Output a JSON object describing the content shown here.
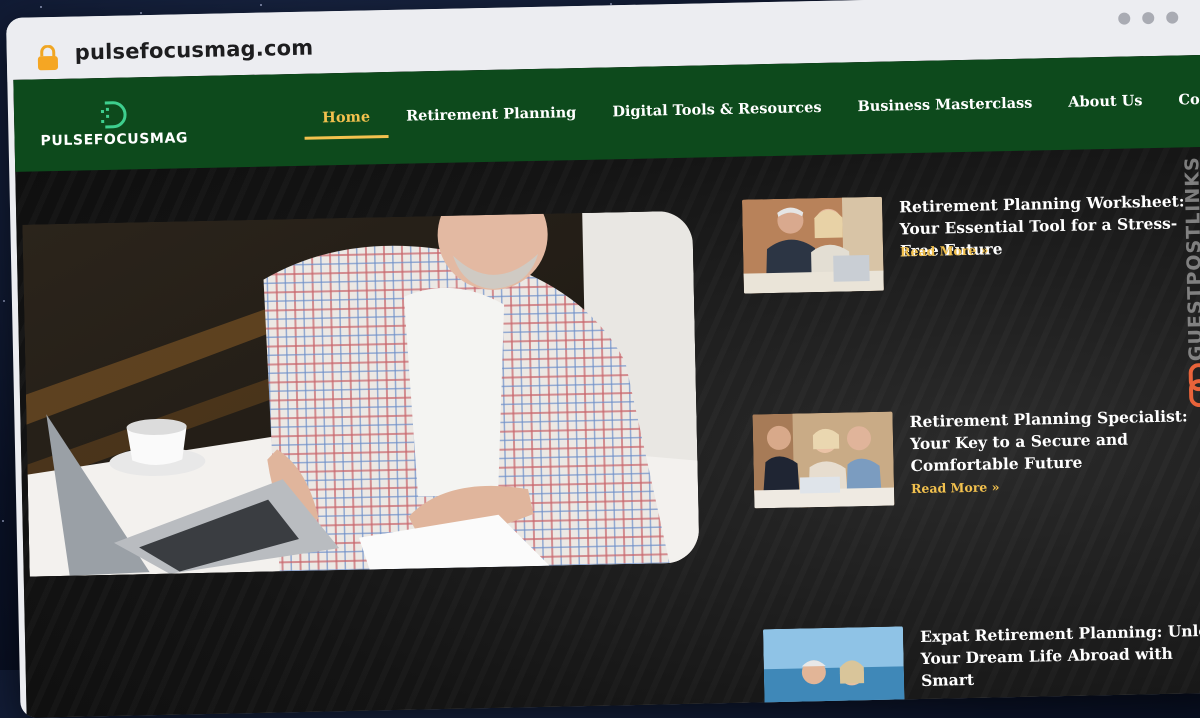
{
  "browser": {
    "url": "pulsefocusmag.com"
  },
  "brand": {
    "name": "PULSEFOCUSMAG"
  },
  "nav": {
    "items": [
      {
        "label": "Home",
        "active": true
      },
      {
        "label": "Retirement Planning"
      },
      {
        "label": "Digital Tools & Resources"
      },
      {
        "label": "Business Masterclass"
      },
      {
        "label": "About Us"
      },
      {
        "label": "Contact Us"
      }
    ]
  },
  "posts": [
    {
      "title": "Retirement Planning Worksheet: Your Essential Tool for a Stress-Free Future",
      "read_more": "Read More »"
    },
    {
      "title": "Retirement Planning Specialist: Your Key to a Secure and Comfortable Future",
      "read_more": "Read More »"
    },
    {
      "title": "Expat Retirement Planning: Unlock Your Dream Life Abroad with Smart"
    }
  ],
  "watermark": {
    "text": "GUESTPOSTLINKS"
  },
  "colors": {
    "nav_bg": "#0d4a1c",
    "accent": "#f2c14e"
  }
}
